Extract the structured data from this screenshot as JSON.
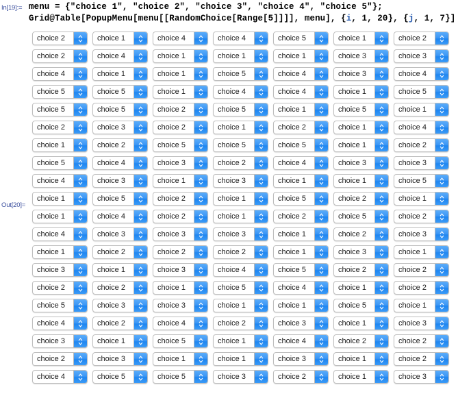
{
  "notebook": {
    "in_label": "In[19]:=",
    "out_label": "Out[20]=",
    "code": {
      "line1": "menu = {\"choice 1\", \"choice 2\", \"choice 3\", \"choice 4\", \"choice 5\"};",
      "line2_a": "Grid@Table[PopupMenu[menu[[RandomChoice[Range[5]]]], menu], {",
      "line2_i": "i",
      "line2_b": ", 1, 20}, {",
      "line2_j": "j",
      "line2_c": ", 1, 7}]"
    }
  },
  "popup_menu": {
    "options": [
      "choice 1",
      "choice 2",
      "choice 3",
      "choice 4",
      "choice 5"
    ],
    "icon": "up-down-chevron-icon",
    "button_color": "#3d97f5",
    "border_color": "#bfbfbf",
    "background_color": "#ffffff"
  },
  "grid": {
    "rows": 20,
    "columns": 7,
    "values": [
      [
        "choice 2",
        "choice 1",
        "choice 4",
        "choice 4",
        "choice 5",
        "choice 1",
        "choice 2"
      ],
      [
        "choice 2",
        "choice 4",
        "choice 1",
        "choice 1",
        "choice 1",
        "choice 3",
        "choice 3"
      ],
      [
        "choice 4",
        "choice 1",
        "choice 1",
        "choice 5",
        "choice 4",
        "choice 3",
        "choice 4"
      ],
      [
        "choice 5",
        "choice 5",
        "choice 1",
        "choice 4",
        "choice 4",
        "choice 1",
        "choice 5"
      ],
      [
        "choice 5",
        "choice 5",
        "choice 2",
        "choice 5",
        "choice 1",
        "choice 5",
        "choice 1"
      ],
      [
        "choice 2",
        "choice 3",
        "choice 2",
        "choice 1",
        "choice 2",
        "choice 1",
        "choice 4"
      ],
      [
        "choice 1",
        "choice 2",
        "choice 5",
        "choice 5",
        "choice 5",
        "choice 1",
        "choice 2"
      ],
      [
        "choice 5",
        "choice 4",
        "choice 3",
        "choice 2",
        "choice 4",
        "choice 3",
        "choice 3"
      ],
      [
        "choice 4",
        "choice 3",
        "choice 1",
        "choice 3",
        "choice 1",
        "choice 1",
        "choice 5"
      ],
      [
        "choice 1",
        "choice 5",
        "choice 2",
        "choice 1",
        "choice 5",
        "choice 2",
        "choice 1"
      ],
      [
        "choice 1",
        "choice 4",
        "choice 2",
        "choice 1",
        "choice 2",
        "choice 5",
        "choice 2"
      ],
      [
        "choice 4",
        "choice 3",
        "choice 3",
        "choice 3",
        "choice 1",
        "choice 2",
        "choice 3"
      ],
      [
        "choice 1",
        "choice 2",
        "choice 2",
        "choice 2",
        "choice 1",
        "choice 3",
        "choice 1"
      ],
      [
        "choice 3",
        "choice 1",
        "choice 3",
        "choice 4",
        "choice 5",
        "choice 2",
        "choice 2"
      ],
      [
        "choice 2",
        "choice 2",
        "choice 1",
        "choice 5",
        "choice 4",
        "choice 1",
        "choice 2"
      ],
      [
        "choice 5",
        "choice 3",
        "choice 3",
        "choice 1",
        "choice 1",
        "choice 5",
        "choice 1"
      ],
      [
        "choice 4",
        "choice 2",
        "choice 4",
        "choice 2",
        "choice 3",
        "choice 1",
        "choice 3"
      ],
      [
        "choice 3",
        "choice 1",
        "choice 5",
        "choice 1",
        "choice 4",
        "choice 2",
        "choice 2"
      ],
      [
        "choice 2",
        "choice 3",
        "choice 1",
        "choice 1",
        "choice 3",
        "choice 1",
        "choice 2"
      ],
      [
        "choice 4",
        "choice 5",
        "choice 5",
        "choice 3",
        "choice 2",
        "choice 1",
        "choice 3"
      ]
    ]
  }
}
